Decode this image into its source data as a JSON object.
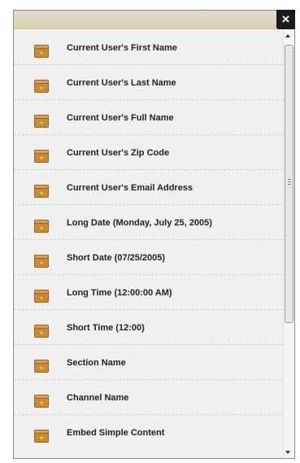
{
  "dialog": {
    "close_label": "×"
  },
  "items": [
    {
      "label": "Current User's First Name",
      "icon": "package-icon"
    },
    {
      "label": "Current User's Last Name",
      "icon": "package-icon"
    },
    {
      "label": "Current User's Full Name",
      "icon": "package-icon"
    },
    {
      "label": "Current User's Zip Code",
      "icon": "package-icon"
    },
    {
      "label": "Current User's Email Address",
      "icon": "package-icon"
    },
    {
      "label": "Long Date (Monday, July 25, 2005)",
      "icon": "package-icon"
    },
    {
      "label": "Short Date (07/25/2005)",
      "icon": "package-icon"
    },
    {
      "label": "Long Time (12:00:00 AM)",
      "icon": "package-icon"
    },
    {
      "label": "Short Time (12:00)",
      "icon": "package-icon"
    },
    {
      "label": "Section Name",
      "icon": "package-icon"
    },
    {
      "label": "Channel Name",
      "icon": "package-icon"
    },
    {
      "label": "Embed Simple Content",
      "icon": "package-icon"
    }
  ],
  "colors": {
    "header": "#d8cfb4",
    "icon_box": "#c98a3a",
    "icon_bolt": "#f2d24a",
    "close_bg": "#1a1a1a"
  }
}
